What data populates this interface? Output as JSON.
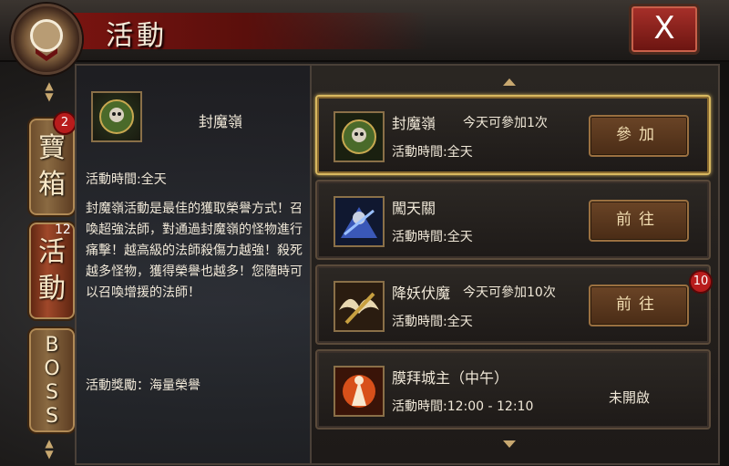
{
  "header": {
    "title": "活動",
    "close_label": "X"
  },
  "tabs": [
    {
      "label": "寶箱",
      "badge": "2"
    },
    {
      "label": "活動",
      "badge": "12"
    },
    {
      "label": "BOSS"
    }
  ],
  "detail": {
    "name": "封魔嶺",
    "time": "活動時間:全天",
    "description": "封魔嶺活動是最佳的獲取榮譽方式！召喚超強法師，對通過封魔嶺的怪物進行痛擊！越高級的法師殺傷力越強！殺死越多怪物，獲得榮譽也越多！您隨時可以召喚增援的法師！",
    "reward": "活動獎勵：海量榮譽"
  },
  "activities": [
    {
      "name": "封魔嶺",
      "limit": "今天可參加1次",
      "time": "活動時間:全天",
      "button": "參加",
      "icon": "demon-skull-icon",
      "selected": true
    },
    {
      "name": "闖天關",
      "limit": "",
      "time": "活動時間:全天",
      "button": "前往",
      "icon": "warrior-icon"
    },
    {
      "name": "降妖伏魔",
      "limit": "今天可參加10次",
      "time": "活動時間:全天",
      "button": "前往",
      "badge": "10",
      "icon": "sword-wings-icon"
    },
    {
      "name": "膜拜城主（中午）",
      "limit": "",
      "time": "活動時間:12:00 - 12:10",
      "status": "未開啟",
      "icon": "fire-lord-icon"
    }
  ]
}
